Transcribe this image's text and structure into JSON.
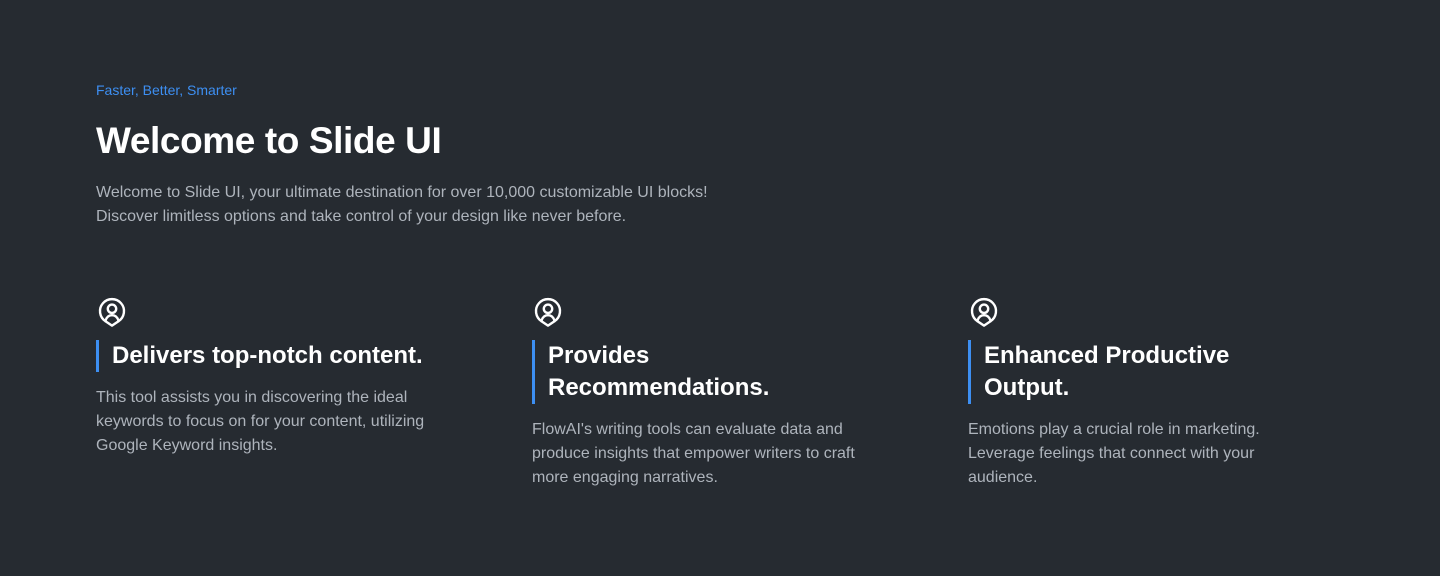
{
  "hero": {
    "eyebrow": "Faster, Better, Smarter",
    "title": "Welcome to Slide UI",
    "description": "Welcome to Slide UI, your ultimate destination for over 10,000 customizable UI blocks! Discover limitless options and take control of your design like never before."
  },
  "features": [
    {
      "icon": "user-circle-icon",
      "title": "Delivers top-notch content.",
      "text": "This tool assists you in discovering the ideal keywords to focus on for your content, utilizing Google Keyword insights."
    },
    {
      "icon": "user-circle-icon",
      "title": "Provides Recommendations.",
      "text": "FlowAI's writing tools can evaluate data and produce insights that empower writers to craft more engaging narratives."
    },
    {
      "icon": "user-circle-icon",
      "title": "Enhanced Productive Output.",
      "text": "Emotions play a crucial role in marketing. Leverage feelings that connect with your audience."
    }
  ],
  "colors": {
    "background": "#262b31",
    "accent": "#3d8ff2",
    "heading": "#ffffff",
    "body_text": "#aeb4bc"
  }
}
